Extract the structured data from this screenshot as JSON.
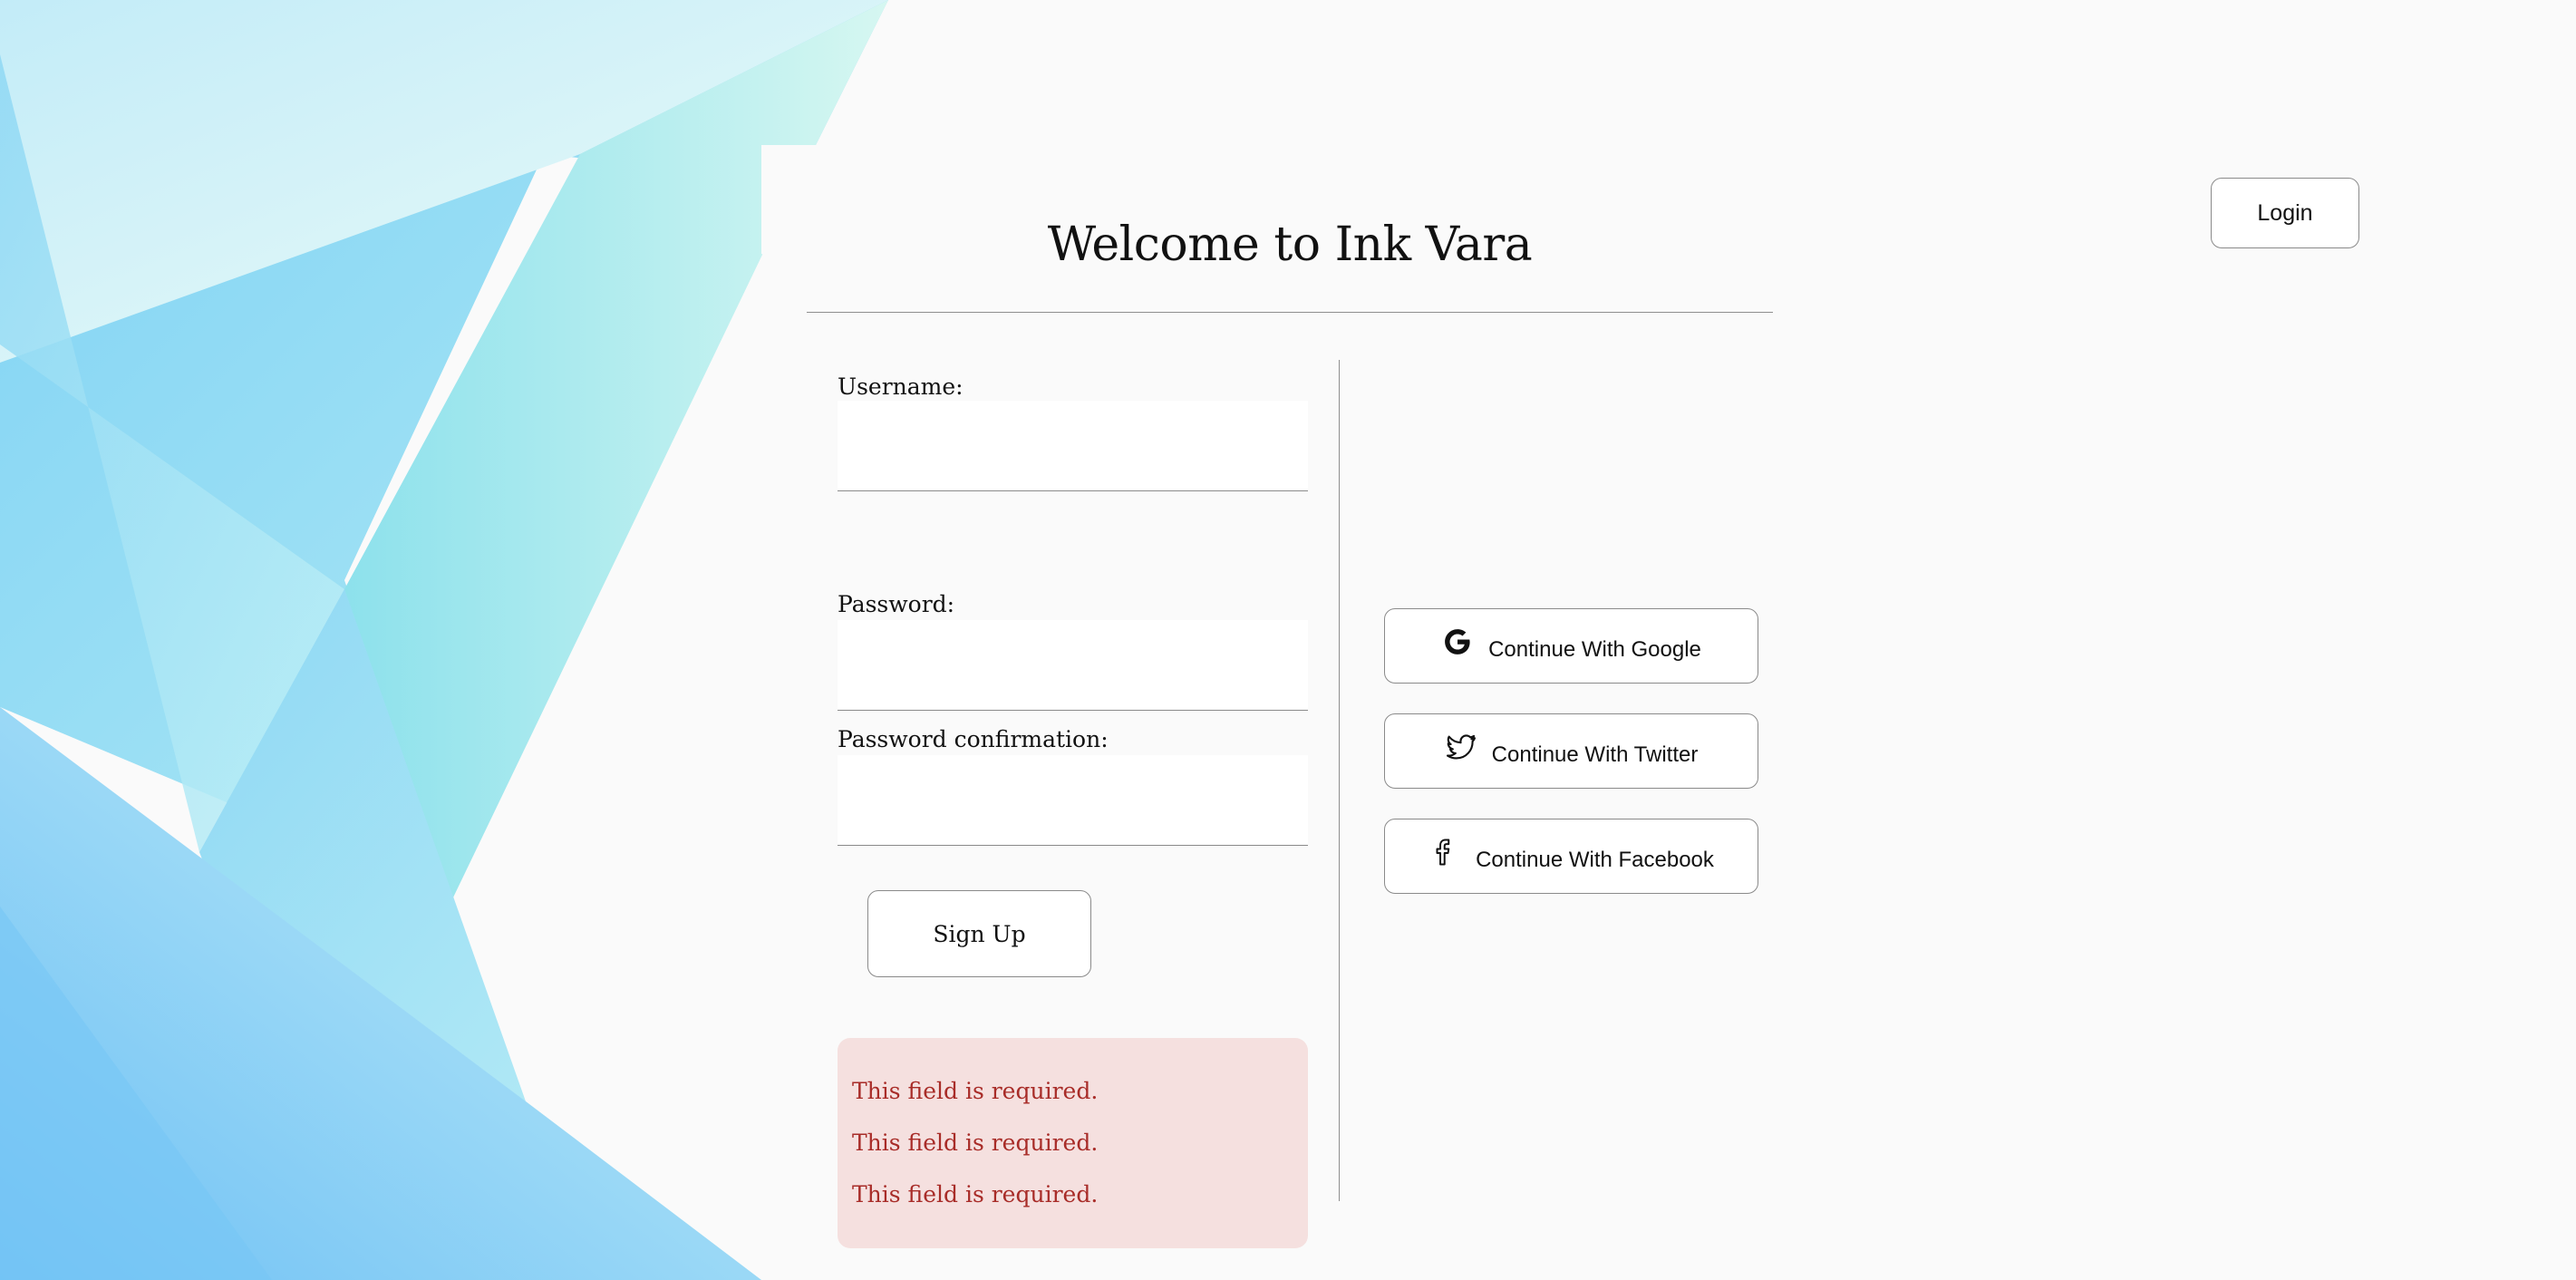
{
  "header": {
    "login_label": "Login",
    "title": "Welcome to Ink Vara"
  },
  "form": {
    "username_label": "Username:",
    "username_value": "",
    "password_label": "Password:",
    "password_value": "",
    "password_confirm_label": "Password confirmation:",
    "password_confirm_value": "",
    "signup_label": "Sign Up",
    "errors": [
      "This field is required.",
      "This field is required.",
      "This field is required."
    ],
    "error_text_color": "#a82c28",
    "error_bg_color": "#f5e0df"
  },
  "social": {
    "google": {
      "label": "Continue With Google",
      "icon": "google-icon"
    },
    "twitter": {
      "label": "Continue With Twitter",
      "icon": "twitter-icon"
    },
    "facebook": {
      "label": "Continue With Facebook",
      "icon": "facebook-icon"
    }
  },
  "colors": {
    "page_background": "#fafafa",
    "background_art": [
      "#6cc3f5",
      "#8ee0ea",
      "#b8f0e8",
      "#d8f6f6"
    ]
  }
}
